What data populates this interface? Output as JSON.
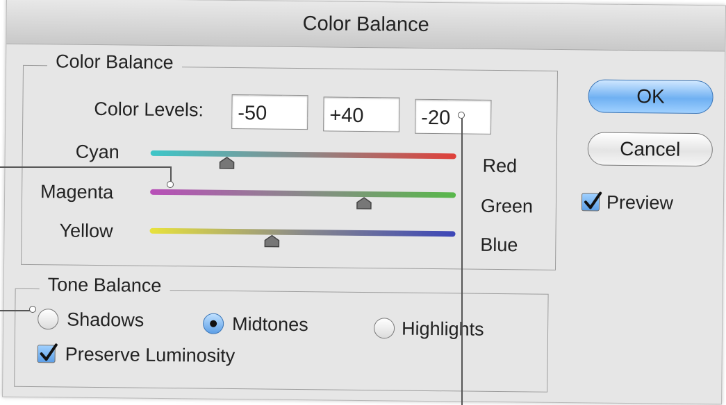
{
  "window": {
    "title": "Color Balance"
  },
  "color_balance": {
    "group_label": "Color Balance",
    "levels_label": "Color Levels:",
    "levels": [
      "-50",
      "+40",
      "-20"
    ],
    "sliders": [
      {
        "left": "Cyan",
        "right": "Red",
        "position": 0.25
      },
      {
        "left": "Magenta",
        "right": "Green",
        "position": 0.7
      },
      {
        "left": "Yellow",
        "right": "Blue",
        "position": 0.4
      }
    ]
  },
  "tone_balance": {
    "group_label": "Tone Balance",
    "options": [
      "Shadows",
      "Midtones",
      "Highlights"
    ],
    "selected": "Midtones",
    "preserve_luminosity": "Preserve Luminosity",
    "preserve_checked": true
  },
  "buttons": {
    "ok": "OK",
    "cancel": "Cancel"
  },
  "preview": {
    "label": "Preview",
    "checked": true
  },
  "colors": {
    "accent": "#5d9fe6",
    "cyan": "#3ec6c8",
    "red": "#e0403a",
    "magenta": "#b84fb8",
    "green": "#58b84a",
    "yellow": "#e8e23c",
    "blue": "#3c46b8"
  },
  "icons": {
    "thumb": "slider-thumb-icon",
    "check": "checkmark-icon"
  }
}
